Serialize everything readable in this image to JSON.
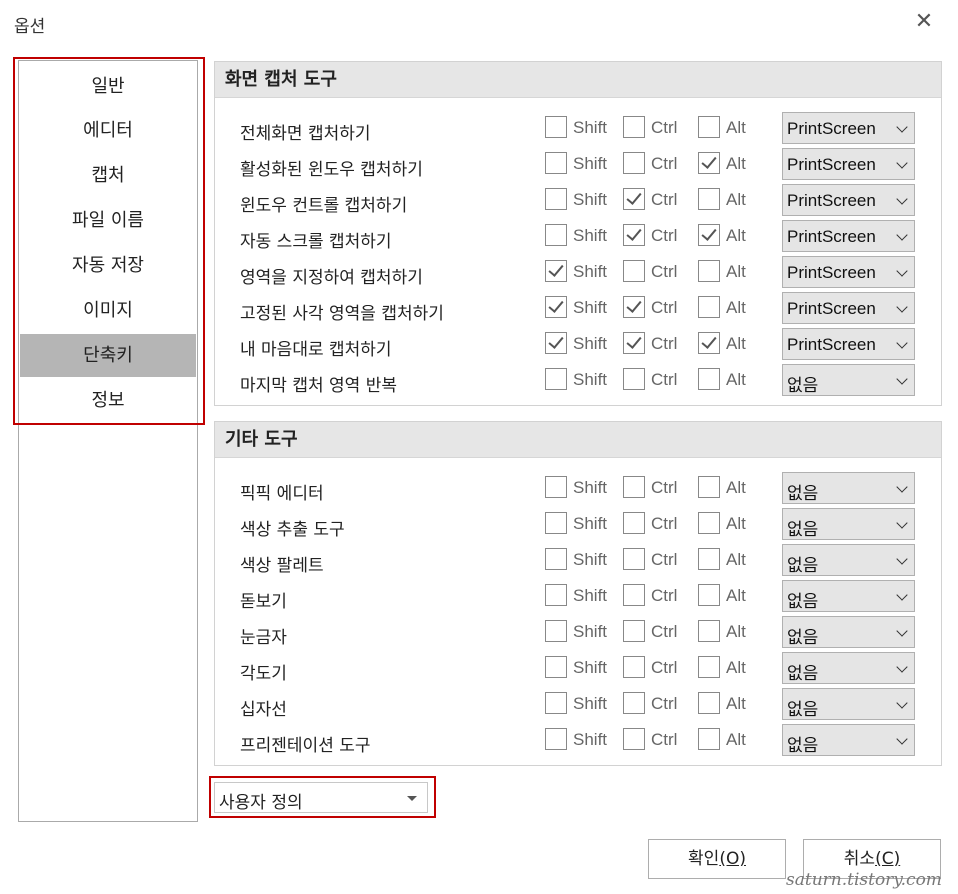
{
  "window": {
    "title": "옵션",
    "close_icon": "close-icon"
  },
  "nav": {
    "items": [
      {
        "label": "일반",
        "selected": false
      },
      {
        "label": "에디터",
        "selected": false
      },
      {
        "label": "캡처",
        "selected": false
      },
      {
        "label": "파일 이름",
        "selected": false
      },
      {
        "label": "자동 저장",
        "selected": false
      },
      {
        "label": "이미지",
        "selected": false
      },
      {
        "label": "단축키",
        "selected": true
      },
      {
        "label": "정보",
        "selected": false
      }
    ]
  },
  "modifier_labels": {
    "shift": "Shift",
    "ctrl": "Ctrl",
    "alt": "Alt"
  },
  "sections": [
    {
      "title": "화면 캡처 도구",
      "rows": [
        {
          "label": "전체화면 캡처하기",
          "shift": false,
          "ctrl": false,
          "alt": false,
          "key": "PrintScreen"
        },
        {
          "label": "활성화된 윈도우 캡처하기",
          "shift": false,
          "ctrl": false,
          "alt": true,
          "key": "PrintScreen"
        },
        {
          "label": "윈도우 컨트롤 캡처하기",
          "shift": false,
          "ctrl": true,
          "alt": false,
          "key": "PrintScreen"
        },
        {
          "label": "자동 스크롤 캡처하기",
          "shift": false,
          "ctrl": true,
          "alt": true,
          "key": "PrintScreen"
        },
        {
          "label": "영역을 지정하여 캡처하기",
          "shift": true,
          "ctrl": false,
          "alt": false,
          "key": "PrintScreen"
        },
        {
          "label": "고정된 사각 영역을 캡처하기",
          "shift": true,
          "ctrl": true,
          "alt": false,
          "key": "PrintScreen"
        },
        {
          "label": "내 마음대로 캡처하기",
          "shift": true,
          "ctrl": true,
          "alt": true,
          "key": "PrintScreen"
        },
        {
          "label": "마지막 캡처 영역 반복",
          "shift": false,
          "ctrl": false,
          "alt": false,
          "key": "없음"
        }
      ]
    },
    {
      "title": "기타 도구",
      "rows": [
        {
          "label": "픽픽 에디터",
          "shift": false,
          "ctrl": false,
          "alt": false,
          "key": "없음"
        },
        {
          "label": "색상 추출 도구",
          "shift": false,
          "ctrl": false,
          "alt": false,
          "key": "없음"
        },
        {
          "label": "색상 팔레트",
          "shift": false,
          "ctrl": false,
          "alt": false,
          "key": "없음"
        },
        {
          "label": "돋보기",
          "shift": false,
          "ctrl": false,
          "alt": false,
          "key": "없음"
        },
        {
          "label": "눈금자",
          "shift": false,
          "ctrl": false,
          "alt": false,
          "key": "없음"
        },
        {
          "label": "각도기",
          "shift": false,
          "ctrl": false,
          "alt": false,
          "key": "없음"
        },
        {
          "label": "십자선",
          "shift": false,
          "ctrl": false,
          "alt": false,
          "key": "없음"
        },
        {
          "label": "프리젠테이션 도구",
          "shift": false,
          "ctrl": false,
          "alt": false,
          "key": "없음"
        }
      ]
    }
  ],
  "preset": {
    "value": "사용자 정의"
  },
  "buttons": {
    "ok": {
      "text": "확인",
      "mnemonic": "(O)"
    },
    "cancel": {
      "text": "취소",
      "mnemonic": "(C)"
    }
  },
  "watermark": "saturn.tistory.com"
}
